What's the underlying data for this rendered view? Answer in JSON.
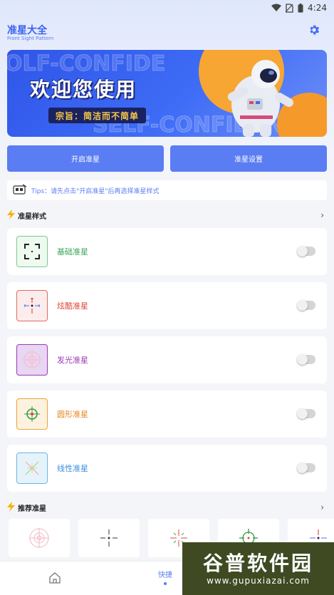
{
  "status_bar": {
    "time": "4:24"
  },
  "header": {
    "title": "准星大全",
    "subtitle": "Front Sight Pattern",
    "settings_icon": "gear-icon"
  },
  "banner": {
    "bg_text_1": "OLF-CONFIDE",
    "bg_text_2": "SELF-CONFIDEN",
    "title": "欢迎您使用",
    "tagline": "宗旨：简洁而不简单"
  },
  "actions": {
    "start_label": "开启准星",
    "settings_label": "准星设置"
  },
  "tips": {
    "text": "Tips：请先点击\"开启准星\"后再选择准星样式"
  },
  "styles_section": {
    "title": "准星样式",
    "items": [
      {
        "label": "基础准星",
        "color": "#3aa55a",
        "icon": "basic-crosshair-icon",
        "enabled": false
      },
      {
        "label": "炫酷准星",
        "color": "#e0443a",
        "icon": "cool-crosshair-icon",
        "enabled": false
      },
      {
        "label": "发光准星",
        "color": "#9b3ab8",
        "icon": "glow-crosshair-icon",
        "enabled": false
      },
      {
        "label": "圆形准星",
        "color": "#e8861f",
        "icon": "circle-crosshair-icon",
        "enabled": false
      },
      {
        "label": "线性准星",
        "color": "#3b8ee0",
        "icon": "linear-crosshair-icon",
        "enabled": false
      }
    ]
  },
  "recommended_section": {
    "title": "推荐准星"
  },
  "bottom_nav": {
    "quick_label": "快捷"
  },
  "watermark": {
    "big": "谷普软件园",
    "small": "www.gupuxiazai.com"
  },
  "colors": {
    "accent": "#5a7df3",
    "title_blue": "#3a63f0"
  }
}
